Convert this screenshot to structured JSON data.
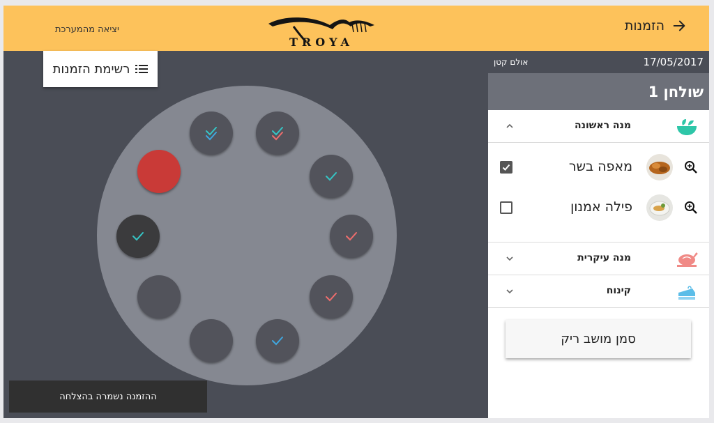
{
  "header": {
    "title": "הזמנות",
    "logout_label": "יציאה מהמערכת",
    "logo_text": "TROYA",
    "background": "#fdc25b"
  },
  "canvas": {
    "orders_list_label": "רשימת הזמנות",
    "snackbar": "ההזמנה נשמרה בהצלחה",
    "seats": [
      {
        "id": "1",
        "state": "double-check",
        "check_colors": [
          "#35c6c6",
          "#3fa7e0"
        ]
      },
      {
        "id": "2",
        "state": "double-check",
        "check_colors": [
          "#35c6c6",
          "#ef6d6d"
        ]
      },
      {
        "id": "3",
        "state": "check",
        "check_colors": [
          "#35c6c6"
        ]
      },
      {
        "id": "4",
        "state": "check",
        "check_colors": [
          "#ef6d6d"
        ]
      },
      {
        "id": "5",
        "state": "check",
        "check_colors": [
          "#ef6d6d"
        ]
      },
      {
        "id": "6",
        "state": "check",
        "check_colors": [
          "#3fa7e0"
        ]
      },
      {
        "id": "7",
        "state": "empty",
        "check_colors": []
      },
      {
        "id": "8",
        "state": "empty",
        "check_colors": []
      },
      {
        "id": "9",
        "state": "selected",
        "check_colors": [
          "#35c6c6"
        ]
      },
      {
        "id": "10",
        "state": "marked-empty",
        "check_colors": []
      }
    ],
    "colors": {
      "seat": "#52535b",
      "seat_selected": "#3b3b3d",
      "seat_marked": "#c93a37",
      "table": "#858891",
      "background": "#4a4d56"
    }
  },
  "panel": {
    "date": "17/05/2017",
    "hall": "אולם קטן",
    "table_title": "שולחן 1",
    "sections": [
      {
        "label": "מנה ראשונה",
        "icon": "salad-bowl-icon",
        "expanded": true
      },
      {
        "label": "מנה עיקרית",
        "icon": "roast-chicken-icon",
        "expanded": false
      },
      {
        "label": "קינוח",
        "icon": "cake-icon",
        "expanded": false
      }
    ],
    "dishes": [
      {
        "name": "מאפה בשר",
        "checked": true,
        "photo": "meat-pastry-photo"
      },
      {
        "name": "פילה אמנון",
        "checked": false,
        "photo": "fish-fillet-photo"
      }
    ],
    "empty_seat_button": "סמן מושב ריק"
  }
}
